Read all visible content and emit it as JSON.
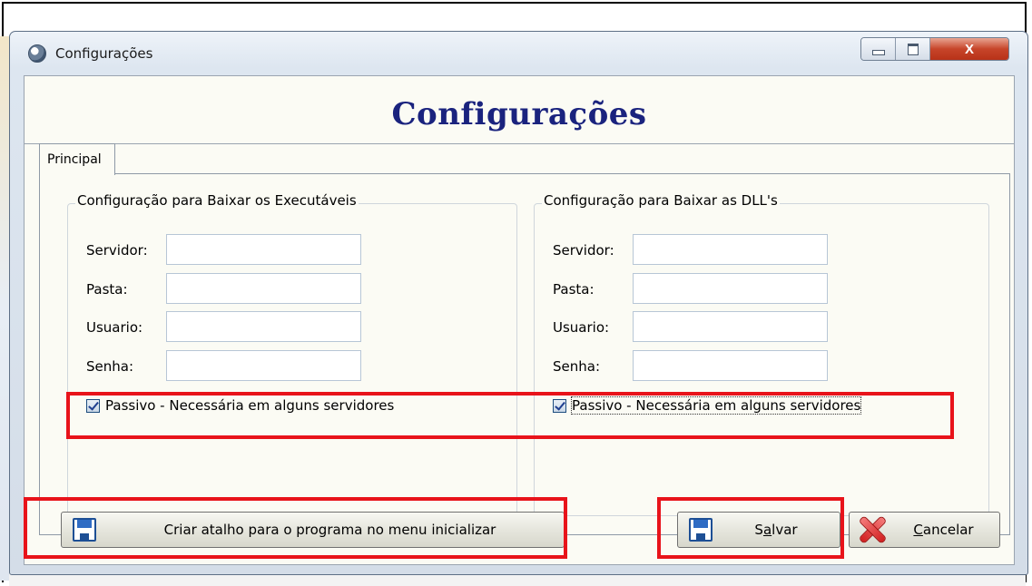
{
  "window": {
    "title": "Configurações",
    "icon": "globe-icon",
    "controls": {
      "minimize": "minimize-icon",
      "maximize": "maximize-icon",
      "close": "X"
    }
  },
  "heading": "Configurações",
  "tabs": [
    {
      "label": "Principal",
      "selected": true
    }
  ],
  "groups": [
    {
      "legend": "Configuração para Baixar os Executáveis",
      "fields": [
        {
          "label": "Servidor:",
          "value": ""
        },
        {
          "label": "Pasta:",
          "value": ""
        },
        {
          "label": "Usuario:",
          "value": ""
        },
        {
          "label": "Senha:",
          "value": ""
        }
      ],
      "checkbox": {
        "label": "Passivo - Necessária em alguns servidores",
        "checked": true
      }
    },
    {
      "legend": "Configuração para Baixar as DLL's",
      "fields": [
        {
          "label": "Servidor:",
          "value": ""
        },
        {
          "label": "Pasta:",
          "value": ""
        },
        {
          "label": "Usuario:",
          "value": ""
        },
        {
          "label": "Senha:",
          "value": ""
        }
      ],
      "checkbox": {
        "label": "Passivo - Necessária em alguns servidores",
        "checked": true
      }
    }
  ],
  "buttons": {
    "shortcut": {
      "label": "Criar atalho para o programa no menu inicializar",
      "icon": "floppy-disk-icon"
    },
    "save": {
      "label_pre": "S",
      "label_ul": "a",
      "label_post": "lvar",
      "icon": "floppy-disk-icon"
    },
    "cancel": {
      "label_ul": "C",
      "label_post": "ancelar",
      "icon": "red-x-icon"
    }
  },
  "colors": {
    "heading": "#1a237e",
    "highlight": "#e8131a",
    "client_bg": "#fbfbf4"
  }
}
